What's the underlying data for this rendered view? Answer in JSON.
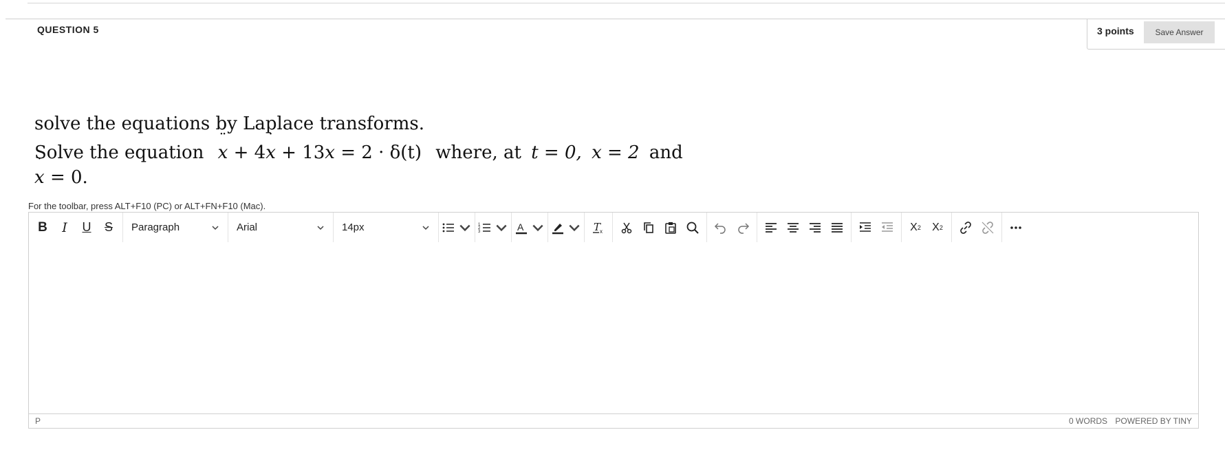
{
  "question": {
    "title": "QUESTION 5",
    "points": "3 points",
    "save_label": "Save Answer"
  },
  "prompt": {
    "line1": "solve the equations by Laplace transforms.",
    "line2_text": "Solve the equation",
    "eq_rest": "+ 4",
    "eq_rest2": "+ 13",
    "eq_rhs": "= 2 · δ(t)",
    "where": "where,  at",
    "cond1": "t = 0,",
    "cond2": "x = 2",
    "and": "and",
    "line3": "= 0."
  },
  "editor": {
    "hint": "For the toolbar, press ALT+F10 (PC) or ALT+FN+F10 (Mac).",
    "block_format": "Paragraph",
    "font_family": "Arial",
    "font_size": "14px",
    "status_path": "P",
    "word_count": "0 WORDS",
    "powered_by": "POWERED BY TINY"
  },
  "icons": [
    "bold-icon",
    "italic-icon",
    "underline-icon",
    "strikethrough-icon",
    "bullet-list-icon",
    "numbered-list-icon",
    "text-color-icon",
    "highlight-icon",
    "clear-format-icon",
    "cut-icon",
    "copy-icon",
    "paste-icon",
    "search-icon",
    "undo-icon",
    "redo-icon",
    "align-left-icon",
    "align-center-icon",
    "align-right-icon",
    "justify-icon",
    "indent-icon",
    "outdent-icon",
    "superscript-icon",
    "subscript-icon",
    "link-icon",
    "unlink-icon",
    "more-icon"
  ]
}
